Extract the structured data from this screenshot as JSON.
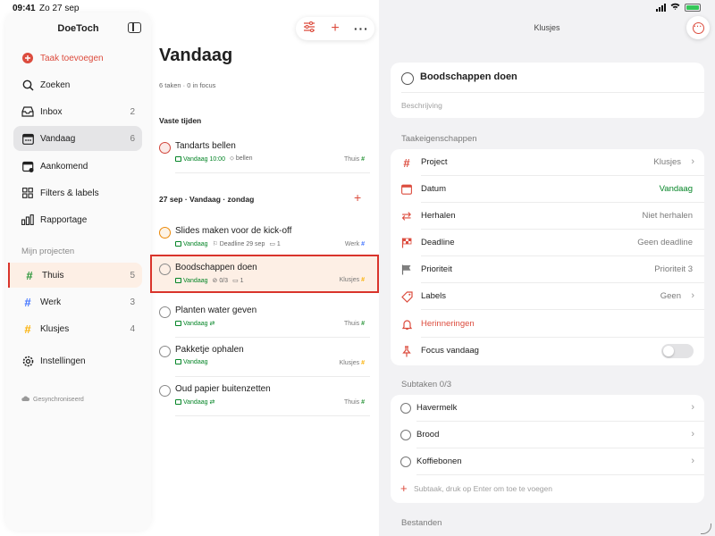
{
  "status": {
    "time": "09:41",
    "date": "Zo 27 sep"
  },
  "sidebar": {
    "title": "DoeToch",
    "items": [
      {
        "label": "Taak toevoegen",
        "count": ""
      },
      {
        "label": "Zoeken",
        "count": ""
      },
      {
        "label": "Inbox",
        "count": "2"
      },
      {
        "label": "Vandaag",
        "count": "6"
      },
      {
        "label": "Aankomend",
        "count": ""
      },
      {
        "label": "Filters & labels",
        "count": ""
      },
      {
        "label": "Rapportage",
        "count": ""
      }
    ],
    "projects_heading": "Mijn projecten",
    "projects": [
      {
        "label": "Thuis",
        "count": "5"
      },
      {
        "label": "Werk",
        "count": "3"
      },
      {
        "label": "Klusjes",
        "count": "4"
      }
    ],
    "settings": "Instellingen",
    "sync": "Gesynchroniseerd"
  },
  "colors": {
    "accent": "#dc4c3e",
    "green": "#058527",
    "thuis": "#299438",
    "werk": "#4073ff",
    "klusjes": "#fab005",
    "priority1": "#d1453b",
    "priority3": "#808080"
  },
  "main": {
    "title": "Vandaag",
    "subtitle": "6 taken · 0 in focus",
    "section_fixed": "Vaste tijden",
    "section_date": "27 sep · Vandaag · zondag",
    "tasks": [
      {
        "name": "Tandarts bellen",
        "date": "Vandaag 10:00",
        "extra1": "bellen",
        "extra2": "",
        "project": "Thuis"
      },
      {
        "name": "Slides maken voor de kick-off",
        "date": "Vandaag",
        "extra1": "Deadline 29 sep",
        "extra2": "1",
        "project": "Werk"
      },
      {
        "name": "Boodschappen doen",
        "date": "Vandaag",
        "extra1": "0/3",
        "extra2": "1",
        "project": "Klusjes"
      },
      {
        "name": "Planten water geven",
        "date": "Vandaag",
        "extra1": "",
        "extra2": "",
        "project": "Thuis"
      },
      {
        "name": "Pakketje ophalen",
        "date": "Vandaag",
        "extra1": "",
        "extra2": "",
        "project": "Klusjes"
      },
      {
        "name": "Oud papier buitenzetten",
        "date": "Vandaag",
        "extra1": "",
        "extra2": "",
        "project": "Thuis"
      }
    ]
  },
  "detail": {
    "header": "Klusjes",
    "task_name": "Boodschappen doen",
    "description_placeholder": "Beschrijving",
    "props_heading": "Taakeigenschappen",
    "props": [
      {
        "label": "Project",
        "value": "Klusjes"
      },
      {
        "label": "Datum",
        "value": "Vandaag"
      },
      {
        "label": "Herhalen",
        "value": "Niet herhalen"
      },
      {
        "label": "Deadline",
        "value": "Geen deadline"
      },
      {
        "label": "Prioriteit",
        "value": "Prioriteit 3"
      },
      {
        "label": "Labels",
        "value": "Geen"
      },
      {
        "label": "Herinneringen",
        "value": ""
      },
      {
        "label": "Focus vandaag",
        "value": ""
      }
    ],
    "focus_today": false,
    "subtasks_heading": "Subtaken 0/3",
    "subtasks": [
      "Havermelk",
      "Brood",
      "Koffiebonen"
    ],
    "add_subtask_placeholder": "Subtaak, druk op Enter om toe te voegen",
    "files_heading": "Bestanden"
  }
}
